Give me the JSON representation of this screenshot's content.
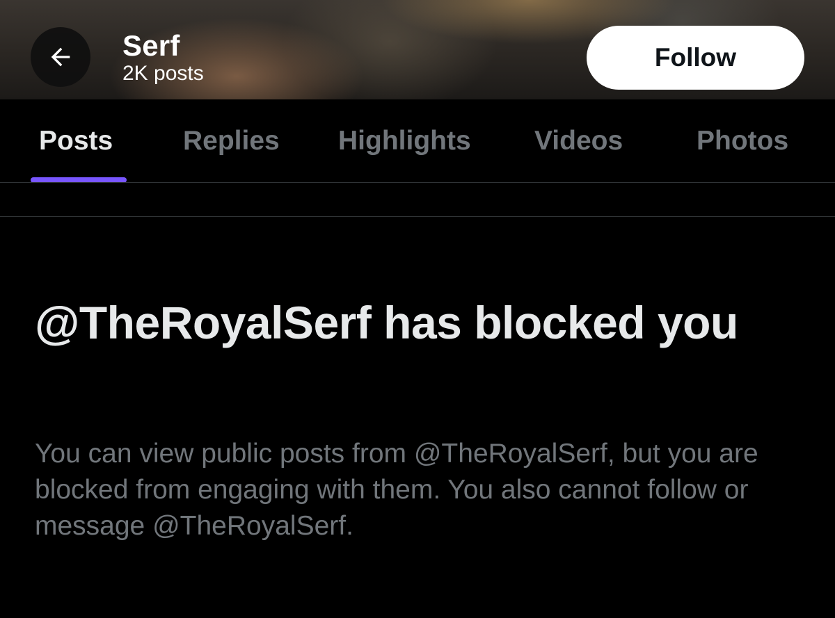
{
  "header": {
    "name": "Serf",
    "post_count": "2K posts",
    "follow_label": "Follow"
  },
  "tabs": [
    {
      "label": "Posts",
      "active": true
    },
    {
      "label": "Replies",
      "active": false
    },
    {
      "label": "Highlights",
      "active": false
    },
    {
      "label": "Videos",
      "active": false
    },
    {
      "label": "Photos",
      "active": false
    }
  ],
  "blocked": {
    "title": "@TheRoyalSerf has blocked you",
    "description": "You can view public posts from @TheRoyalSerf, but you are blocked from engaging with them. You also cannot follow or message @TheRoyalSerf."
  },
  "colors": {
    "background": "#000000",
    "primary_text": "#e7e9ea",
    "secondary_text": "#71767b",
    "tab_indicator": "#7856ff",
    "divider": "#2f3336",
    "follow_button_bg": "#ffffff"
  },
  "icons": {
    "back": "arrow-left-icon"
  }
}
